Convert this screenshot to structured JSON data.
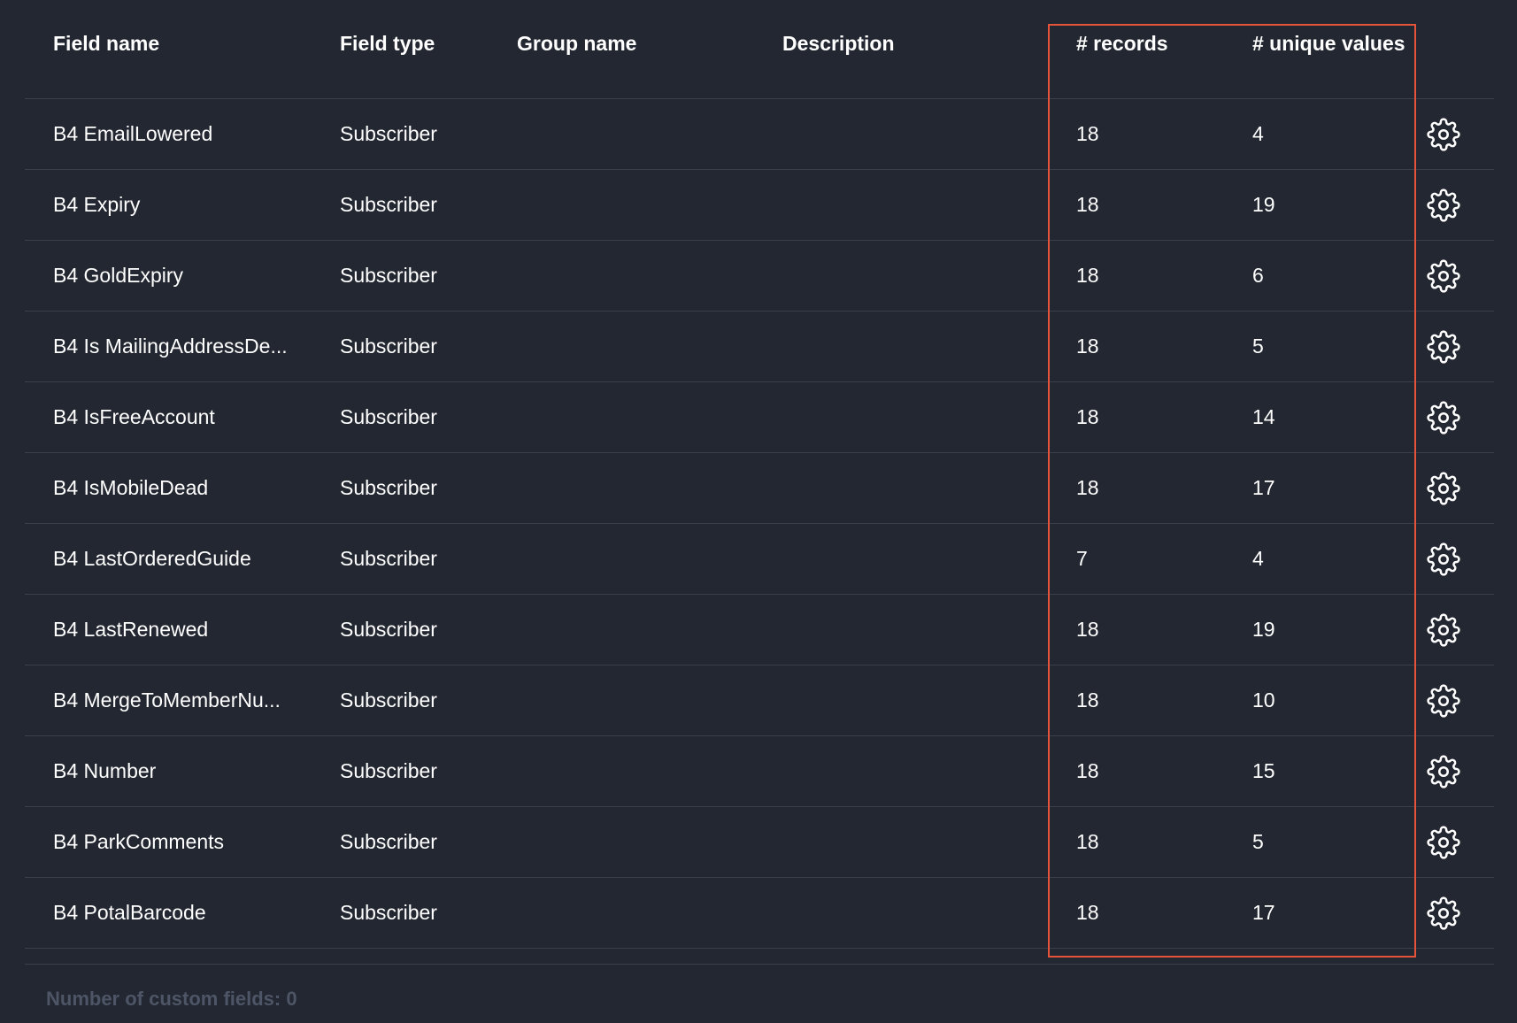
{
  "table": {
    "headers": {
      "field_name": "Field name",
      "field_type": "Field type",
      "group_name": "Group name",
      "description": "Description",
      "records": "# records",
      "unique_values": "# unique values"
    },
    "rows": [
      {
        "name": "B4 EmailLowered",
        "type": "Subscriber",
        "group": "",
        "description": "",
        "records": "18",
        "unique": "4"
      },
      {
        "name": "B4 Expiry",
        "type": "Subscriber",
        "group": "",
        "description": "",
        "records": "18",
        "unique": "19"
      },
      {
        "name": "B4 GoldExpiry",
        "type": "Subscriber",
        "group": "",
        "description": "",
        "records": "18",
        "unique": "6"
      },
      {
        "name": "B4 Is MailingAddressDe...",
        "type": "Subscriber",
        "group": "",
        "description": "",
        "records": "18",
        "unique": "5"
      },
      {
        "name": "B4 IsFreeAccount",
        "type": "Subscriber",
        "group": "",
        "description": "",
        "records": "18",
        "unique": "14"
      },
      {
        "name": "B4 IsMobileDead",
        "type": "Subscriber",
        "group": "",
        "description": "",
        "records": "18",
        "unique": "17"
      },
      {
        "name": "B4 LastOrderedGuide",
        "type": "Subscriber",
        "group": "",
        "description": "",
        "records": "7",
        "unique": "4"
      },
      {
        "name": "B4 LastRenewed",
        "type": "Subscriber",
        "group": "",
        "description": "",
        "records": "18",
        "unique": "19"
      },
      {
        "name": "B4 MergeToMemberNu...",
        "type": "Subscriber",
        "group": "",
        "description": "",
        "records": "18",
        "unique": "10"
      },
      {
        "name": "B4 Number",
        "type": "Subscriber",
        "group": "",
        "description": "",
        "records": "18",
        "unique": "15"
      },
      {
        "name": "B4 ParkComments",
        "type": "Subscriber",
        "group": "",
        "description": "",
        "records": "18",
        "unique": "5"
      },
      {
        "name": "B4 PotalBarcode",
        "type": "Subscriber",
        "group": "",
        "description": "",
        "records": "18",
        "unique": "17"
      }
    ],
    "row_action_icon": "gear-icon"
  },
  "footer": {
    "custom_fields_count": "Number of custom fields: 0"
  },
  "colors": {
    "background": "#232731",
    "divider": "#3a3f4b",
    "highlight": "#e5533a",
    "muted_text": "#4d5566"
  }
}
